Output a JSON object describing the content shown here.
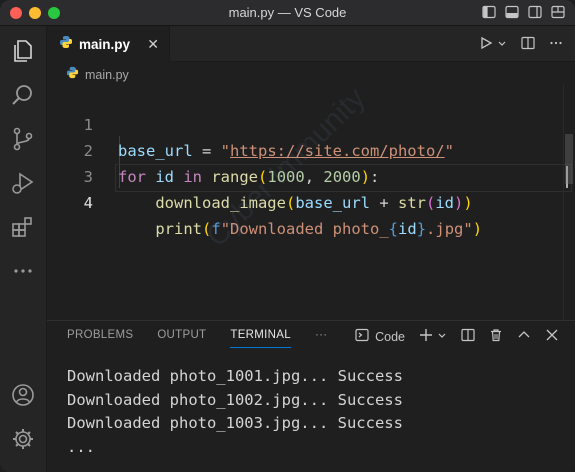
{
  "window": {
    "title": "main.py — VS Code"
  },
  "tabs": [
    {
      "label": "main.py",
      "icon": "python-icon"
    }
  ],
  "breadcrumb": {
    "file": "main.py"
  },
  "editor": {
    "line_numbers": [
      "1",
      "2",
      "3",
      "4"
    ],
    "code": {
      "l1": {
        "var": "base_url",
        "op": " = ",
        "q1": "\"",
        "url": "https://site.com/photo/",
        "q2": "\""
      },
      "l2": {
        "kw_for": "for",
        "var": " id ",
        "kw_in": "in",
        "sp": " ",
        "fn": "range",
        "open": "(",
        "n1": "1000",
        "comma": ", ",
        "n2": "2000",
        "close": ")",
        "colon": ":"
      },
      "l3": {
        "indent": "    ",
        "fn": "download_image",
        "open": "(",
        "var": "base_url",
        "op": " + ",
        "fn2": "str",
        "open2": "(",
        "arg": "id",
        "close2": ")",
        "close": ")"
      },
      "l4": {
        "indent": "    ",
        "fn": "print",
        "open": "(",
        "prefix": "f",
        "s1": "\"Downloaded photo_",
        "b1": "{",
        "arg": "id",
        "b2": "}",
        "s2": ".jpg\"",
        "close": ")"
      }
    }
  },
  "panel": {
    "tabs": [
      "PROBLEMS",
      "OUTPUT",
      "TERMINAL"
    ],
    "active_tab": "TERMINAL",
    "more": "···",
    "terminal_name": "Code",
    "terminal_lines": [
      "Downloaded photo_1001.jpg... Success",
      "Downloaded photo_1002.jpg... Success",
      "Downloaded photo_1003.jpg... Success",
      "..."
    ]
  },
  "watermark": "Cyber Immunity",
  "colors": {
    "accent": "#0078d4",
    "traffic_red": "#fe5f57",
    "traffic_yellow": "#febc2e",
    "traffic_green": "#28c840"
  }
}
